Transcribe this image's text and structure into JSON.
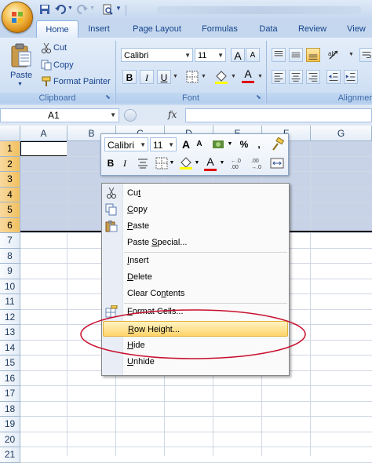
{
  "quick_access": {
    "icons": [
      "save-icon",
      "undo-icon",
      "redo-icon",
      "print-preview-icon",
      "customize-qat-icon"
    ]
  },
  "tabs": [
    "Home",
    "Insert",
    "Page Layout",
    "Formulas",
    "Data",
    "Review",
    "View"
  ],
  "active_tab": "Home",
  "clipboard": {
    "paste": "Paste",
    "cut": "Cut",
    "copy": "Copy",
    "format_painter": "Format Painter",
    "group_label": "Clipboard"
  },
  "font_group": {
    "font_name": "Calibri",
    "font_size": "11",
    "bold": "B",
    "italic": "I",
    "underline": "U",
    "font_color_glyph": "A",
    "grow": "A",
    "shrink": "A",
    "group_label": "Font"
  },
  "alignment_group": {
    "group_label": "Alignmer"
  },
  "formula_bar": {
    "name_box": "A1",
    "fx": "fx",
    "formula": ""
  },
  "columns": [
    "A",
    "B",
    "C",
    "D",
    "E",
    "F",
    "G"
  ],
  "rows": [
    "1",
    "2",
    "3",
    "4",
    "5",
    "6",
    "7",
    "8",
    "9",
    "10",
    "11",
    "12",
    "13",
    "14",
    "15",
    "16",
    "17",
    "18",
    "19",
    "20",
    "21"
  ],
  "selected_rows": [
    "1",
    "2",
    "3",
    "4",
    "5",
    "6"
  ],
  "mini_toolbar": {
    "font_name": "Calibri",
    "font_size": "11",
    "grow": "A",
    "shrink": "A",
    "currency": "$",
    "percent": "%",
    "comma": ",",
    "bold": "B",
    "italic": "I",
    "font_color": "A",
    "increase_decimal": ".0→.00",
    "decrease_decimal": ".00→.0"
  },
  "context_menu": {
    "items": [
      {
        "pre": "Cu",
        "u": "t",
        "post": "",
        "icon": "scissors-icon"
      },
      {
        "pre": "",
        "u": "C",
        "post": "opy",
        "icon": "copy-icon"
      },
      {
        "pre": "",
        "u": "P",
        "post": "aste",
        "icon": "paste-icon"
      },
      {
        "pre": "Paste ",
        "u": "S",
        "post": "pecial...",
        "icon": ""
      },
      {
        "pre": "",
        "u": "I",
        "post": "nsert",
        "icon": ""
      },
      {
        "pre": "",
        "u": "D",
        "post": "elete",
        "icon": ""
      },
      {
        "pre": "Clear Co",
        "u": "n",
        "post": "tents",
        "icon": ""
      },
      {
        "pre": "",
        "u": "F",
        "post": "ormat Cells...",
        "icon": "format-cells-icon"
      },
      {
        "pre": "",
        "u": "R",
        "post": "ow Height...",
        "icon": ""
      },
      {
        "pre": "",
        "u": "H",
        "post": "ide",
        "icon": ""
      },
      {
        "pre": "",
        "u": "U",
        "post": "nhide",
        "icon": ""
      }
    ],
    "highlighted": "Row Height..."
  },
  "colors": {
    "annotation": "#c8102e",
    "selection": "#c8d3e7",
    "highlight": "#ffd46a"
  }
}
